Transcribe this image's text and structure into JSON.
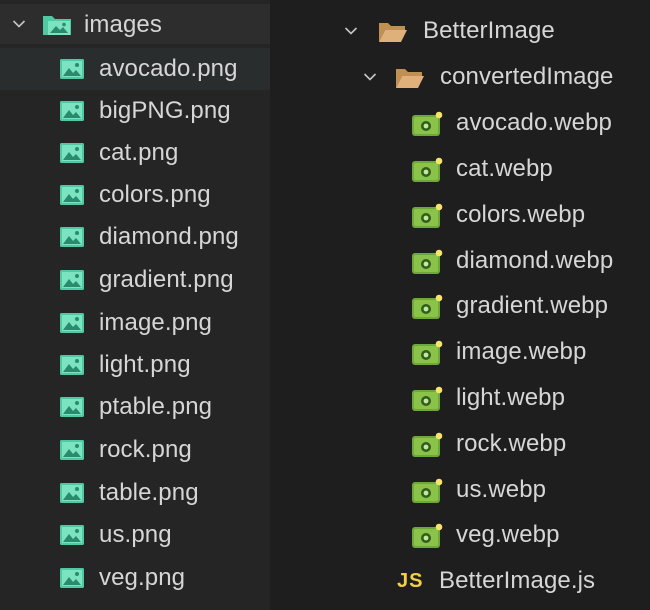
{
  "left_tree": {
    "folder": {
      "label": "images",
      "expanded": true,
      "icon": "image-folder-icon"
    },
    "files": [
      {
        "label": "avocado.png",
        "selected": true
      },
      {
        "label": "bigPNG.png"
      },
      {
        "label": "cat.png"
      },
      {
        "label": "colors.png"
      },
      {
        "label": "diamond.png"
      },
      {
        "label": "gradient.png"
      },
      {
        "label": "image.png"
      },
      {
        "label": "light.png"
      },
      {
        "label": "ptable.png"
      },
      {
        "label": "rock.png"
      },
      {
        "label": "table.png"
      },
      {
        "label": "us.png"
      },
      {
        "label": "veg.png"
      }
    ],
    "file_icon": "image-file-icon"
  },
  "right_tree": {
    "root": {
      "label": "BetterImage",
      "expanded": true,
      "icon": "open-folder-icon"
    },
    "subfolder": {
      "label": "convertedImage",
      "expanded": true,
      "icon": "open-folder-icon"
    },
    "files": [
      {
        "label": "avocado.webp"
      },
      {
        "label": "cat.webp"
      },
      {
        "label": "colors.webp"
      },
      {
        "label": "diamond.webp"
      },
      {
        "label": "gradient.webp"
      },
      {
        "label": "image.webp"
      },
      {
        "label": "light.webp"
      },
      {
        "label": "rock.webp"
      },
      {
        "label": "us.webp"
      },
      {
        "label": "veg.webp"
      }
    ],
    "file_icon": "webp-file-icon",
    "script_file": {
      "label": "BetterImage.js",
      "icon_text": "JS"
    }
  },
  "colors": {
    "image_icon": "#4ec9a4",
    "webp_icon": "#8bc34a",
    "folder_icon": "#d9a86a",
    "js_icon": "#f1d043"
  }
}
